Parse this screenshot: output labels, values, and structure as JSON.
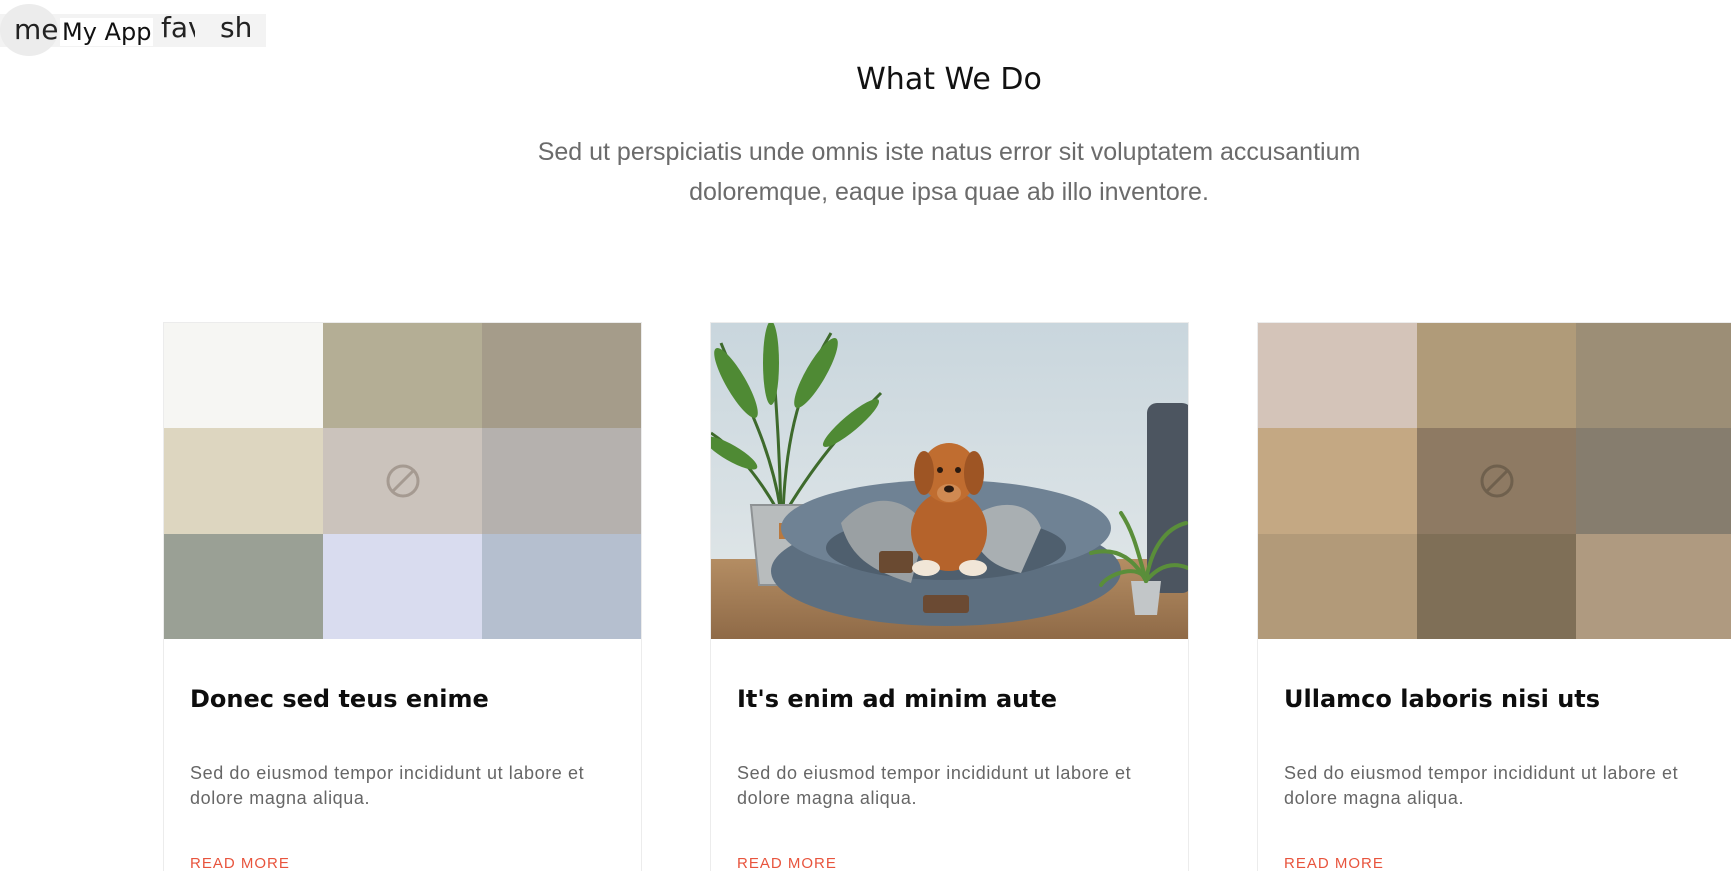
{
  "header": {
    "menu_icon_text": "menu",
    "app_name": "My App",
    "fav_icon_text": "favorite",
    "share_icon_text": "sh"
  },
  "section": {
    "title": "What We Do",
    "subtitle": "Sed ut perspiciatis unde omnis iste natus error sit voluptatem accusantium doloremque, eaque ipsa quae ab illo inventore."
  },
  "cards": [
    {
      "title": "Donec sed teus enime",
      "text": "Sed do eiusmod tempor incididunt ut labore et dolore magna aliqua.",
      "link": "READ MORE",
      "mosaic": [
        "#f6f6f3",
        "#b4ae95",
        "#a59c8a",
        "#ddd6c0",
        "#cbc3bc",
        "#b5b1ae",
        "#9aa095",
        "#d9dcef",
        "#b5bfcf"
      ]
    },
    {
      "title": "It's enim ad minim aute",
      "text": "Sed do eiusmod tempor incididunt ut labore et dolore magna aliqua.",
      "link": "READ MORE"
    },
    {
      "title": "Ullamco laboris nisi uts",
      "text": "Sed do eiusmod tempor incididunt ut labore et dolore magna aliqua.",
      "link": "READ MORE",
      "mosaic": [
        "#d4c4b9",
        "#b09b79",
        "#9c8e76",
        "#c4a883",
        "#8e7a63",
        "#867d6e",
        "#b29a79",
        "#7f6f57",
        "#af9a80"
      ]
    }
  ],
  "colors": {
    "accent": "#e8543d"
  }
}
